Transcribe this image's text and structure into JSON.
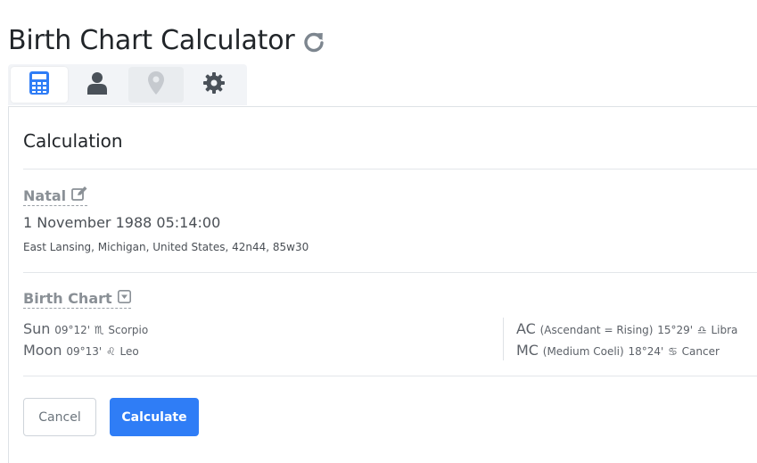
{
  "page": {
    "title": "Birth Chart Calculator",
    "refresh_icon": "refresh-icon"
  },
  "tabs": [
    {
      "icon": "calculator-icon",
      "state": "active"
    },
    {
      "icon": "user-icon",
      "state": "normal"
    },
    {
      "icon": "map-marker-icon",
      "state": "disabled"
    },
    {
      "icon": "gear-icon",
      "state": "normal"
    }
  ],
  "section": {
    "heading": "Calculation"
  },
  "natal": {
    "label": "Natal",
    "edit_icon": "edit-icon",
    "datetime": "1 November 1988 05:14:00",
    "location": "East Lansing, Michigan, United States, 42n44, 85w30"
  },
  "birth_chart": {
    "label": "Birth Chart",
    "toggle_icon": "caret-square-down-icon",
    "left": [
      {
        "name": "Sun",
        "degree": "09°12'",
        "sign_glyph": "♏︎",
        "sign": "Scorpio"
      },
      {
        "name": "Moon",
        "degree": "09°13'",
        "sign_glyph": "♌︎",
        "sign": "Leo"
      }
    ],
    "right": [
      {
        "name": "AC",
        "detail": "(Ascendant = Rising)",
        "degree": "15°29'",
        "sign_glyph": "♎︎",
        "sign": "Libra"
      },
      {
        "name": "MC",
        "detail": "(Medium Coeli)",
        "degree": "18°24'",
        "sign_glyph": "♋︎",
        "sign": "Cancer"
      }
    ]
  },
  "actions": {
    "cancel_label": "Cancel",
    "calculate_label": "Calculate"
  },
  "colors": {
    "primary": "#2f7df6",
    "tab_icon": "#4a5159",
    "muted_label": "#8a9096"
  }
}
